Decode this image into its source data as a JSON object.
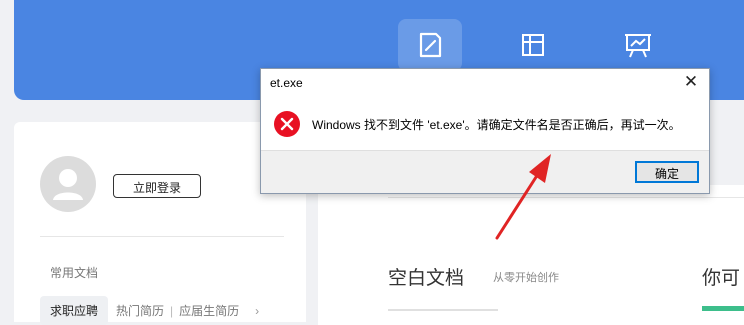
{
  "toolbar": {
    "icons": [
      "document-icon",
      "table-icon",
      "presentation-icon"
    ],
    "accent_color": "#4a85e2"
  },
  "sidebar": {
    "login_label": "立即登录",
    "section_label": "常用文档",
    "tabs": [
      "求职应聘",
      "热门简历",
      "应届生简历"
    ],
    "more_symbol": "›"
  },
  "main": {
    "blank_title": "空白文档",
    "blank_subtitle": "从零开始创作",
    "right_title": "你可"
  },
  "dialog": {
    "title": "et.exe",
    "close_symbol": "✕",
    "message": "Windows 找不到文件 'et.exe'。请确定文件名是否正确后，再试一次。",
    "ok_label": "确定",
    "icon": "error-icon",
    "icon_color": "#e81123"
  },
  "annotation": {
    "arrow_color": "#e02424"
  }
}
